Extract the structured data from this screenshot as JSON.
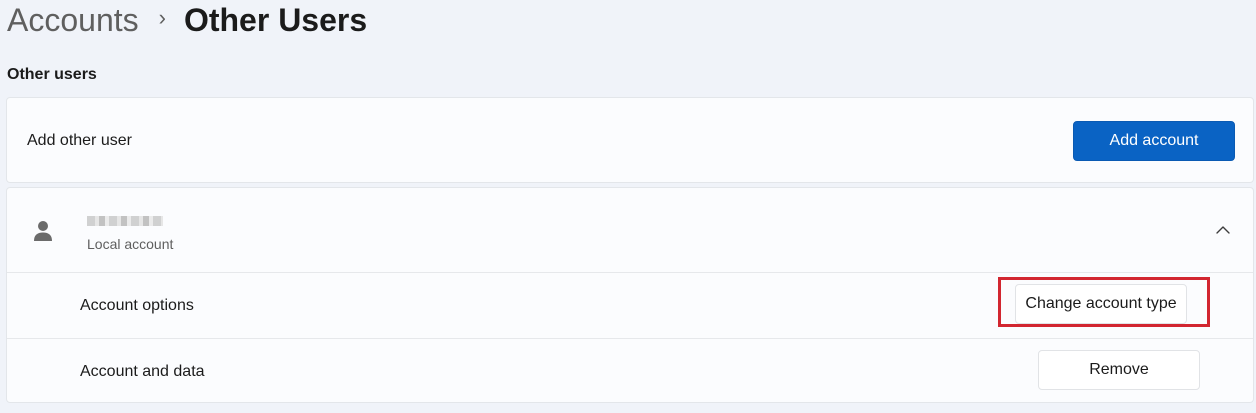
{
  "breadcrumb": {
    "parent": "Accounts",
    "separator": "›",
    "current": "Other Users"
  },
  "section_title": "Other users",
  "add_user_card": {
    "label": "Add other user",
    "button_label": "Add account"
  },
  "user_card": {
    "account_type": "Local account",
    "rows": [
      {
        "label": "Account options",
        "button_label": "Change account type"
      },
      {
        "label": "Account and data",
        "button_label": "Remove"
      }
    ]
  },
  "icons": {
    "avatar": "person-icon",
    "chevron": "chevron-up-icon"
  },
  "colors": {
    "accent": "#0a63c4",
    "highlight": "#d22630",
    "background": "#f0f3f9"
  }
}
